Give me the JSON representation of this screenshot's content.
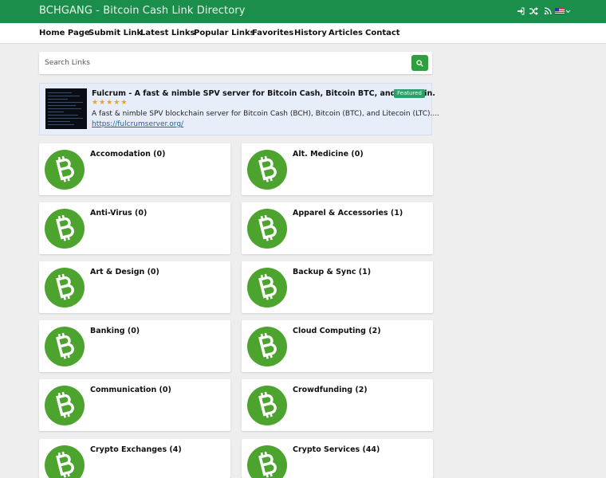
{
  "header": {
    "brand": "BCHGANG - Bitcoin Cash Link Directory",
    "icons": [
      "login-icon",
      "random-icon",
      "rss-icon",
      "us-flag-icon"
    ]
  },
  "nav": [
    "Home Page",
    "Submit Link",
    "Latest Links",
    "Popular Links",
    "Favorites",
    "History",
    "Articles",
    "Contact"
  ],
  "search": {
    "placeholder": "Search Links"
  },
  "featured": {
    "title": "Fulcrum - A fast & nimble SPV server for Bitcoin Cash, Bitcoin BTC, and Litecoin.",
    "badge": "Featured",
    "rating": 5,
    "description": "A fast & nimble SPV blockchain server for Bitcoin Cash (BCH), Bitcoin (BTC), and Litecoin (LTC)....",
    "url": "https://fulcrumserver.org/"
  },
  "colors": {
    "brand_green": "#1b8e4c",
    "bch_green": "#4ca32e",
    "link_blue": "#1a5fb4"
  },
  "categories": [
    "Accomodation (0)",
    "Alt. Medicine (0)",
    "Anti-Virus (0)",
    "Apparel & Accessories (1)",
    "Art & Design (0)",
    "Backup & Sync (1)",
    "Banking (0)",
    "Cloud Computing (2)",
    "Communication (0)",
    "Crowdfunding (2)",
    "Crypto Exchanges (4)",
    "Crypto Services (44)"
  ]
}
